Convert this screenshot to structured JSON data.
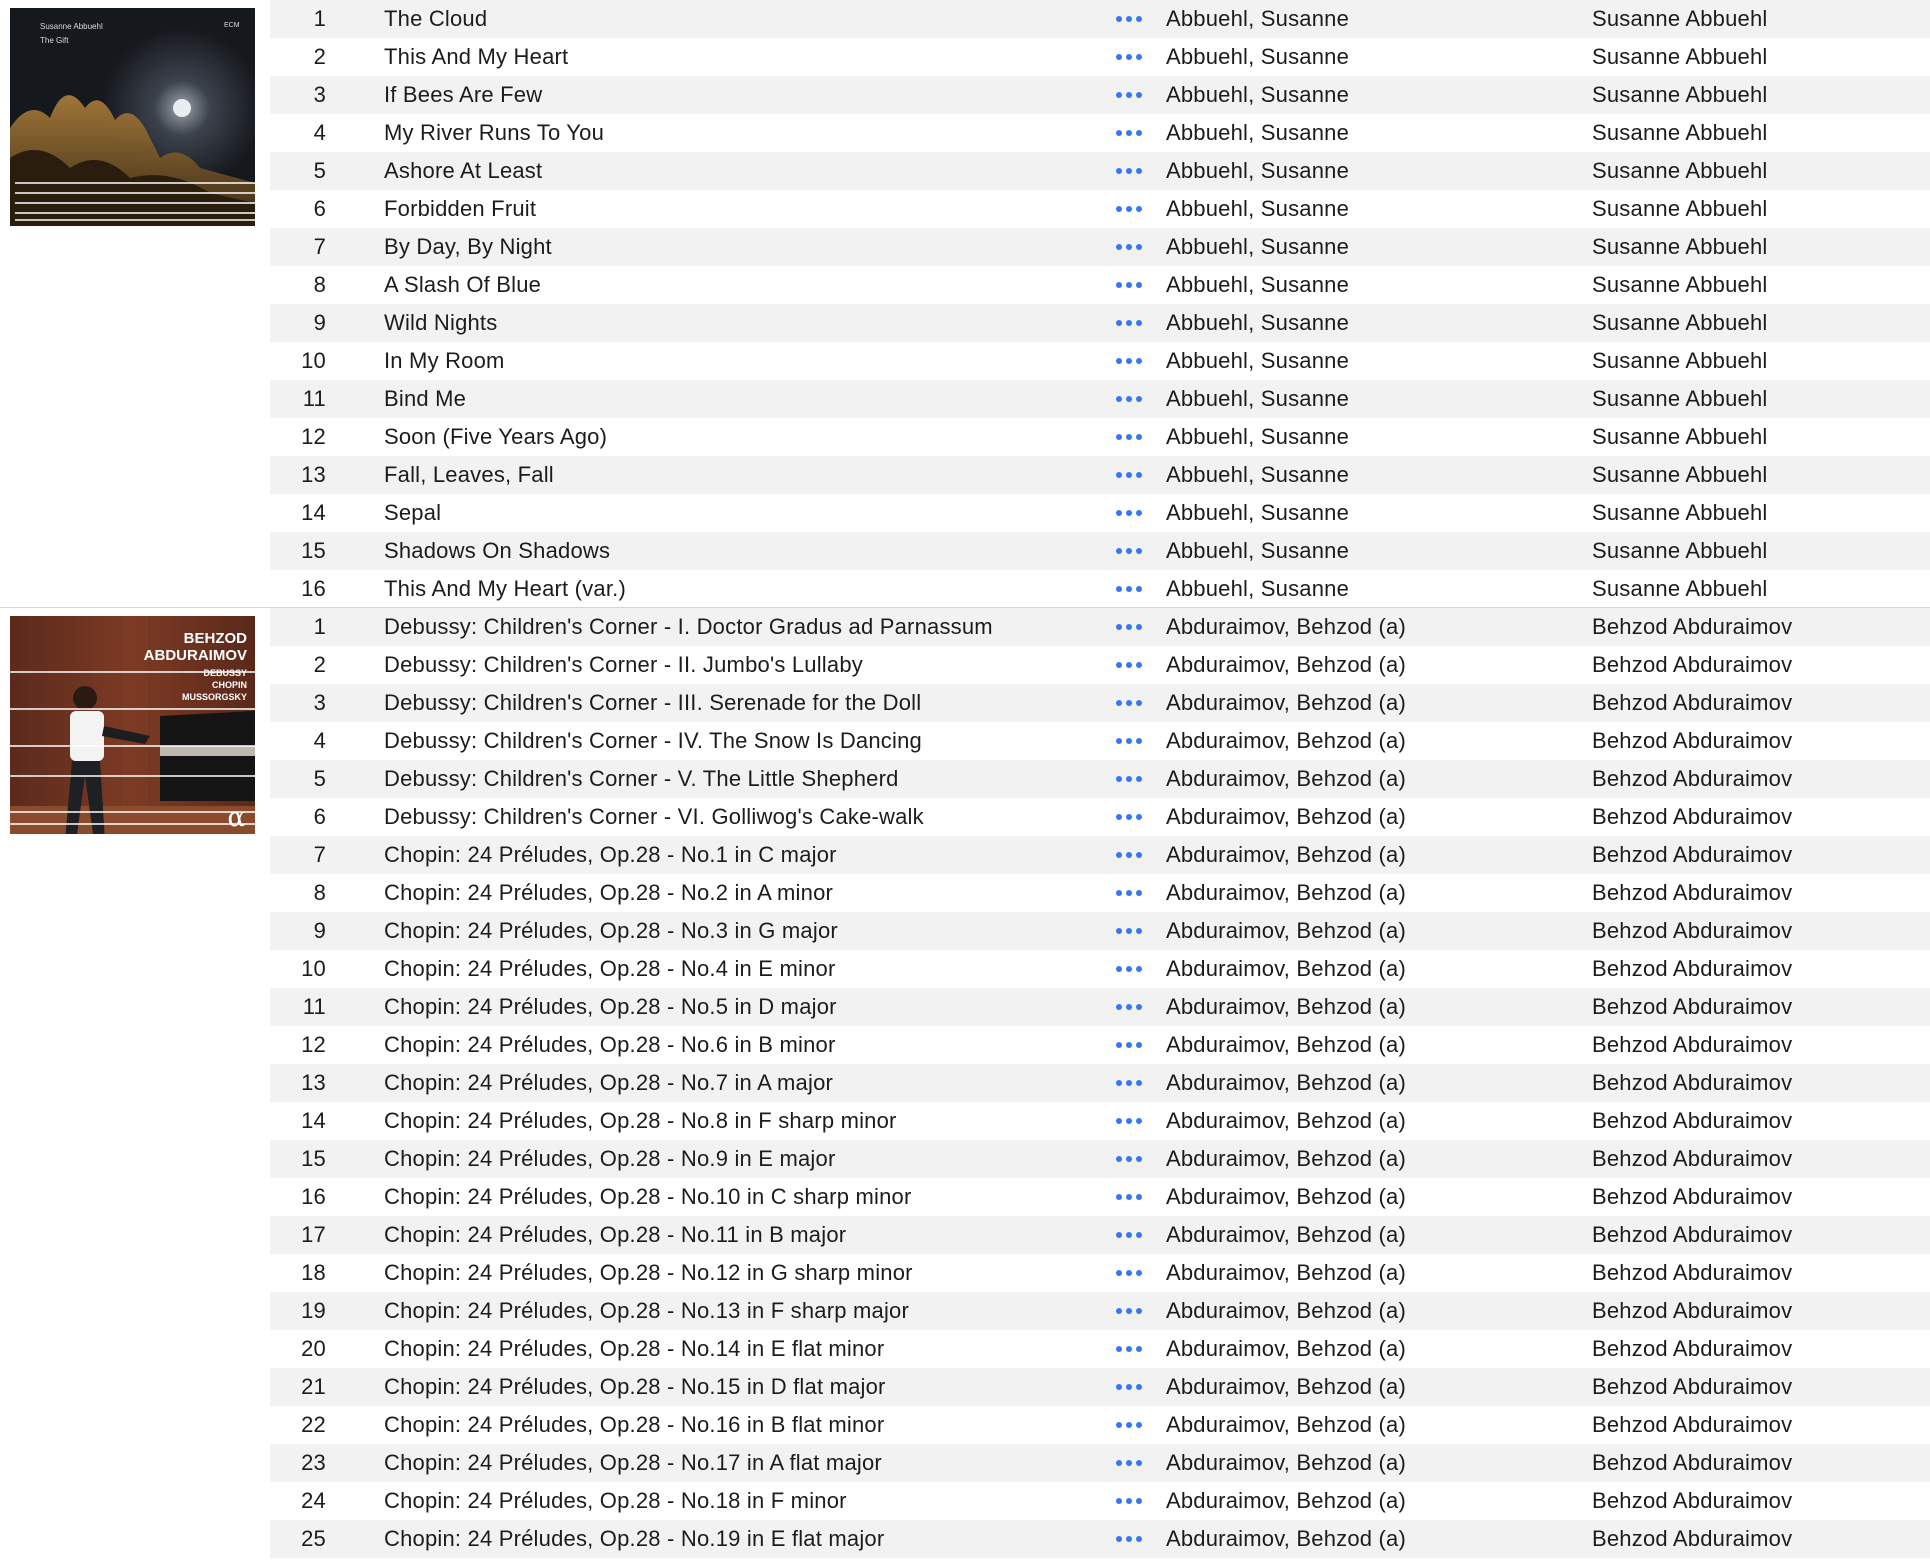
{
  "colors": {
    "accent": "#3478f6",
    "row_alt": "#f2f2f2"
  },
  "albums": [
    {
      "cover": {
        "icon": "album-cover-night-trees",
        "artist_text": "Susanne Abbuehl",
        "title_text": "The Gift",
        "label_text": "ECM"
      },
      "tracks": [
        {
          "num": "1",
          "title": "The Cloud",
          "artist": "Abbuehl, Susanne",
          "album_artist": "Susanne Abbuehl"
        },
        {
          "num": "2",
          "title": "This And My Heart",
          "artist": "Abbuehl, Susanne",
          "album_artist": "Susanne Abbuehl"
        },
        {
          "num": "3",
          "title": "If Bees Are Few",
          "artist": "Abbuehl, Susanne",
          "album_artist": "Susanne Abbuehl"
        },
        {
          "num": "4",
          "title": "My River Runs To You",
          "artist": "Abbuehl, Susanne",
          "album_artist": "Susanne Abbuehl"
        },
        {
          "num": "5",
          "title": "Ashore At Least",
          "artist": "Abbuehl, Susanne",
          "album_artist": "Susanne Abbuehl"
        },
        {
          "num": "6",
          "title": "Forbidden Fruit",
          "artist": "Abbuehl, Susanne",
          "album_artist": "Susanne Abbuehl"
        },
        {
          "num": "7",
          "title": "By Day, By Night",
          "artist": "Abbuehl, Susanne",
          "album_artist": "Susanne Abbuehl"
        },
        {
          "num": "8",
          "title": "A Slash Of Blue",
          "artist": "Abbuehl, Susanne",
          "album_artist": "Susanne Abbuehl"
        },
        {
          "num": "9",
          "title": "Wild Nights",
          "artist": "Abbuehl, Susanne",
          "album_artist": "Susanne Abbuehl"
        },
        {
          "num": "10",
          "title": "In My Room",
          "artist": "Abbuehl, Susanne",
          "album_artist": "Susanne Abbuehl"
        },
        {
          "num": "11",
          "title": "Bind Me",
          "artist": "Abbuehl, Susanne",
          "album_artist": "Susanne Abbuehl"
        },
        {
          "num": "12",
          "title": "Soon (Five Years Ago)",
          "artist": "Abbuehl, Susanne",
          "album_artist": "Susanne Abbuehl"
        },
        {
          "num": "13",
          "title": "Fall, Leaves, Fall",
          "artist": "Abbuehl, Susanne",
          "album_artist": "Susanne Abbuehl"
        },
        {
          "num": "14",
          "title": "Sepal",
          "artist": "Abbuehl, Susanne",
          "album_artist": "Susanne Abbuehl"
        },
        {
          "num": "15",
          "title": "Shadows On Shadows",
          "artist": "Abbuehl, Susanne",
          "album_artist": "Susanne Abbuehl"
        },
        {
          "num": "16",
          "title": "This And My Heart (var.)",
          "artist": "Abbuehl, Susanne",
          "album_artist": "Susanne Abbuehl"
        }
      ]
    },
    {
      "cover": {
        "icon": "album-cover-pianist",
        "name_line1": "BEHZOD",
        "name_line2": "ABDURAIMOV",
        "composer1": "DEBUSSY",
        "composer2": "CHOPIN",
        "composer3": "MUSSORGSKY",
        "label_glyph": "α"
      },
      "tracks": [
        {
          "num": "1",
          "title": "Debussy: Children's Corner - I. Doctor Gradus ad Parnassum",
          "artist": "Abduraimov, Behzod (a)",
          "album_artist": "Behzod Abduraimov"
        },
        {
          "num": "2",
          "title": "Debussy: Children's Corner - II. Jumbo's Lullaby",
          "artist": "Abduraimov, Behzod (a)",
          "album_artist": "Behzod Abduraimov"
        },
        {
          "num": "3",
          "title": "Debussy: Children's Corner - III. Serenade for the Doll",
          "artist": "Abduraimov, Behzod (a)",
          "album_artist": "Behzod Abduraimov"
        },
        {
          "num": "4",
          "title": "Debussy: Children's Corner - IV. The Snow Is Dancing",
          "artist": "Abduraimov, Behzod (a)",
          "album_artist": "Behzod Abduraimov"
        },
        {
          "num": "5",
          "title": "Debussy: Children's Corner - V. The Little Shepherd",
          "artist": "Abduraimov, Behzod (a)",
          "album_artist": "Behzod Abduraimov"
        },
        {
          "num": "6",
          "title": "Debussy: Children's Corner - VI. Golliwog's Cake-walk",
          "artist": "Abduraimov, Behzod (a)",
          "album_artist": "Behzod Abduraimov"
        },
        {
          "num": "7",
          "title": "Chopin: 24 Préludes, Op.28 - No.1 in C major",
          "artist": "Abduraimov, Behzod (a)",
          "album_artist": "Behzod Abduraimov"
        },
        {
          "num": "8",
          "title": "Chopin: 24 Préludes, Op.28 - No.2 in A minor",
          "artist": "Abduraimov, Behzod (a)",
          "album_artist": "Behzod Abduraimov"
        },
        {
          "num": "9",
          "title": "Chopin: 24 Préludes, Op.28 - No.3 in G major",
          "artist": "Abduraimov, Behzod (a)",
          "album_artist": "Behzod Abduraimov"
        },
        {
          "num": "10",
          "title": "Chopin: 24 Préludes, Op.28 - No.4 in E minor",
          "artist": "Abduraimov, Behzod (a)",
          "album_artist": "Behzod Abduraimov"
        },
        {
          "num": "11",
          "title": "Chopin: 24 Préludes, Op.28 - No.5 in D major",
          "artist": "Abduraimov, Behzod (a)",
          "album_artist": "Behzod Abduraimov"
        },
        {
          "num": "12",
          "title": "Chopin: 24 Préludes, Op.28 - No.6 in B minor",
          "artist": "Abduraimov, Behzod (a)",
          "album_artist": "Behzod Abduraimov"
        },
        {
          "num": "13",
          "title": "Chopin: 24 Préludes, Op.28 - No.7 in A major",
          "artist": "Abduraimov, Behzod (a)",
          "album_artist": "Behzod Abduraimov"
        },
        {
          "num": "14",
          "title": "Chopin: 24 Préludes, Op.28 - No.8 in F sharp minor",
          "artist": "Abduraimov, Behzod (a)",
          "album_artist": "Behzod Abduraimov"
        },
        {
          "num": "15",
          "title": "Chopin: 24 Préludes, Op.28 - No.9 in E major",
          "artist": "Abduraimov, Behzod (a)",
          "album_artist": "Behzod Abduraimov"
        },
        {
          "num": "16",
          "title": "Chopin: 24 Préludes, Op.28 - No.10 in C sharp minor",
          "artist": "Abduraimov, Behzod (a)",
          "album_artist": "Behzod Abduraimov"
        },
        {
          "num": "17",
          "title": "Chopin: 24 Préludes, Op.28 - No.11 in B major",
          "artist": "Abduraimov, Behzod (a)",
          "album_artist": "Behzod Abduraimov"
        },
        {
          "num": "18",
          "title": "Chopin: 24 Préludes, Op.28 - No.12 in G sharp minor",
          "artist": "Abduraimov, Behzod (a)",
          "album_artist": "Behzod Abduraimov"
        },
        {
          "num": "19",
          "title": "Chopin: 24 Préludes, Op.28 - No.13 in F sharp major",
          "artist": "Abduraimov, Behzod (a)",
          "album_artist": "Behzod Abduraimov"
        },
        {
          "num": "20",
          "title": "Chopin: 24 Préludes, Op.28 - No.14 in E flat minor",
          "artist": "Abduraimov, Behzod (a)",
          "album_artist": "Behzod Abduraimov"
        },
        {
          "num": "21",
          "title": "Chopin: 24 Préludes, Op.28 - No.15 in D flat major",
          "artist": "Abduraimov, Behzod (a)",
          "album_artist": "Behzod Abduraimov"
        },
        {
          "num": "22",
          "title": "Chopin: 24 Préludes, Op.28 - No.16 in B flat minor",
          "artist": "Abduraimov, Behzod (a)",
          "album_artist": "Behzod Abduraimov"
        },
        {
          "num": "23",
          "title": "Chopin: 24 Préludes, Op.28 - No.17 in A flat major",
          "artist": "Abduraimov, Behzod (a)",
          "album_artist": "Behzod Abduraimov"
        },
        {
          "num": "24",
          "title": "Chopin: 24 Préludes, Op.28 - No.18 in F minor",
          "artist": "Abduraimov, Behzod (a)",
          "album_artist": "Behzod Abduraimov"
        },
        {
          "num": "25",
          "title": "Chopin: 24 Préludes, Op.28 - No.19 in E flat major",
          "artist": "Abduraimov, Behzod (a)",
          "album_artist": "Behzod Abduraimov"
        }
      ]
    }
  ]
}
